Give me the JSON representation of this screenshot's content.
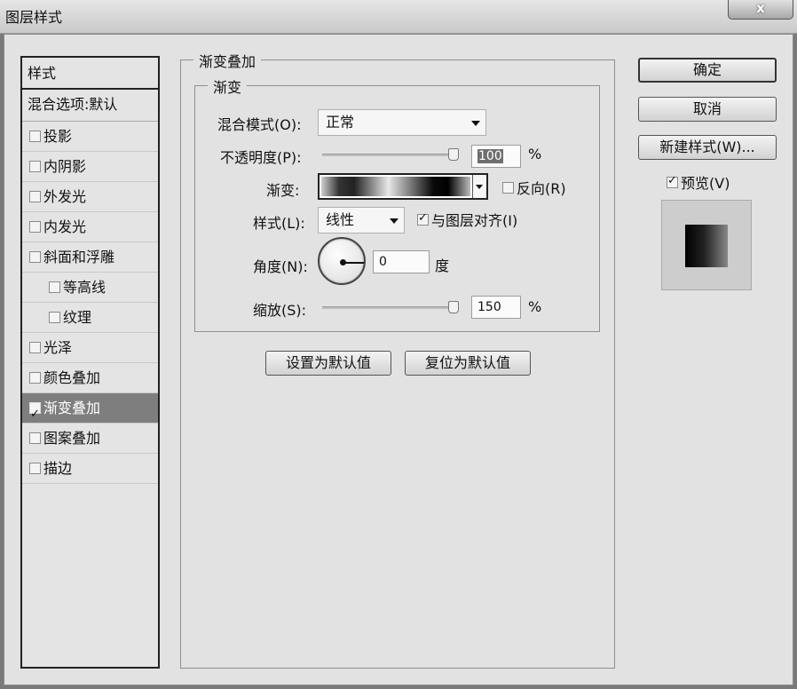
{
  "window": {
    "title": "图层样式",
    "close_label": "x"
  },
  "style_list": {
    "header": "样式",
    "blend_item": "混合选项:默认",
    "items": [
      {
        "label": "投影",
        "checked": false,
        "sub": false,
        "selected": false
      },
      {
        "label": "内阴影",
        "checked": false,
        "sub": false,
        "selected": false
      },
      {
        "label": "外发光",
        "checked": false,
        "sub": false,
        "selected": false
      },
      {
        "label": "内发光",
        "checked": false,
        "sub": false,
        "selected": false
      },
      {
        "label": "斜面和浮雕",
        "checked": false,
        "sub": false,
        "selected": false
      },
      {
        "label": "等高线",
        "checked": false,
        "sub": true,
        "selected": false
      },
      {
        "label": "纹理",
        "checked": false,
        "sub": true,
        "selected": false
      },
      {
        "label": "光泽",
        "checked": false,
        "sub": false,
        "selected": false
      },
      {
        "label": "颜色叠加",
        "checked": false,
        "sub": false,
        "selected": false
      },
      {
        "label": "渐变叠加",
        "checked": true,
        "sub": false,
        "selected": true
      },
      {
        "label": "图案叠加",
        "checked": false,
        "sub": false,
        "selected": false
      },
      {
        "label": "描边",
        "checked": false,
        "sub": false,
        "selected": false
      }
    ]
  },
  "gradient_overlay": {
    "group_title": "渐变叠加",
    "inner_title": "渐变",
    "blend_mode_label": "混合模式(O):",
    "blend_mode_value": "正常",
    "opacity_label": "不透明度(P):",
    "opacity_value": "100",
    "opacity_slider_fraction": 1.0,
    "percent": "%",
    "gradient_label": "渐变:",
    "reverse_label": "反向(R)",
    "reverse_checked": false,
    "style_label": "样式(L):",
    "style_value": "线性",
    "align_label": "与图层对齐(I)",
    "align_checked": true,
    "angle_label": "角度(N):",
    "angle_value": "0",
    "angle_unit": "度",
    "scale_label": "缩放(S):",
    "scale_value": "150",
    "scale_slider_fraction": 1.0,
    "set_default_label": "设置为默认值",
    "reset_default_label": "复位为默认值"
  },
  "actions": {
    "ok_label": "确定",
    "cancel_label": "取消",
    "new_style_label": "新建样式(W)...",
    "preview_label": "预览(V)",
    "preview_checked": true
  },
  "icons": {
    "close": "close-icon",
    "dropdown": "chevron-down-icon",
    "checkbox": "checkbox-icon",
    "angle_dial": "angle-dial-icon"
  }
}
